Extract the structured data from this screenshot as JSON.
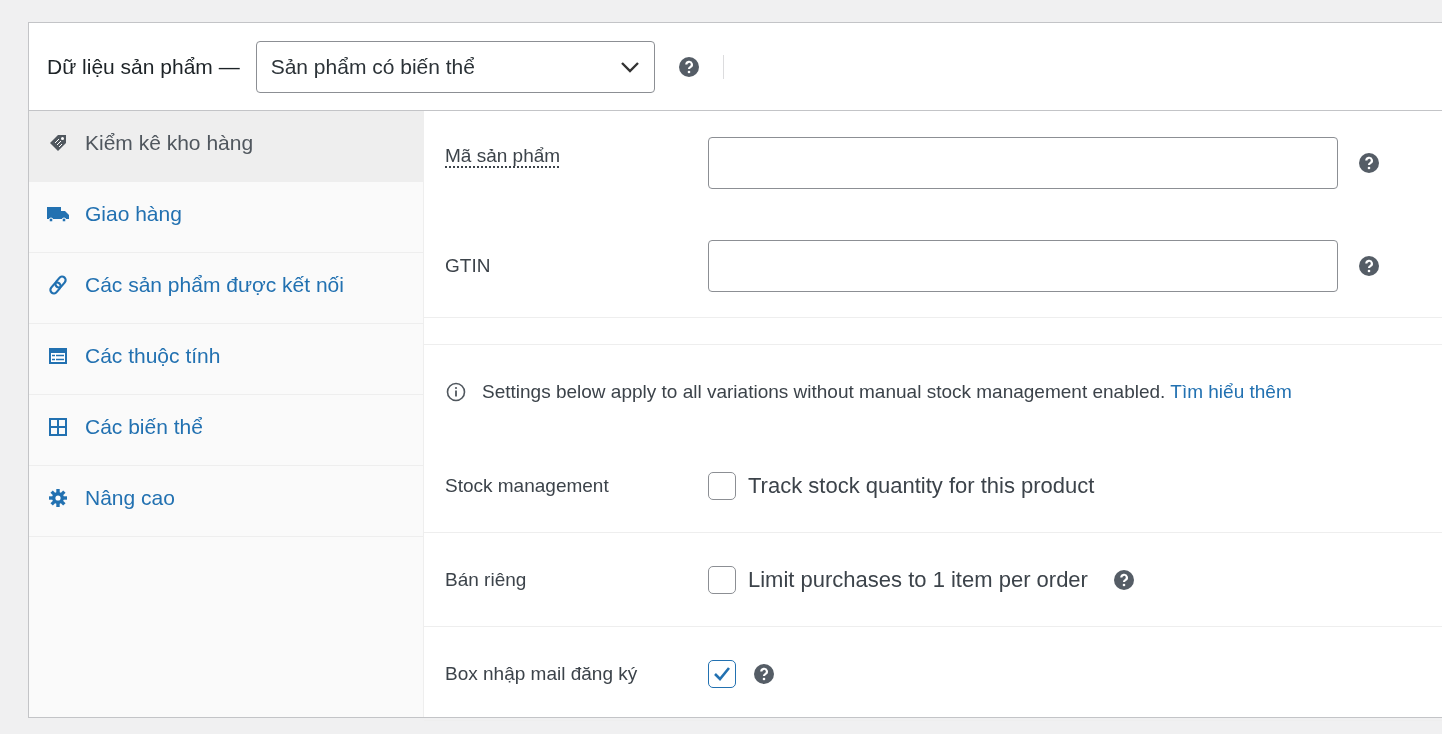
{
  "header": {
    "label": "Dữ liệu sản phẩm —",
    "product_type": "Sản phẩm có biến thể",
    "help": true
  },
  "tabs": [
    {
      "label": "Kiểm kê kho hàng",
      "kind": "tag",
      "selected": true
    },
    {
      "label": "Giao hàng",
      "kind": "truck",
      "selected": false
    },
    {
      "label": "Các sản phẩm được kết nối",
      "kind": "link",
      "selected": false
    },
    {
      "label": "Các thuộc tính",
      "kind": "list",
      "selected": false
    },
    {
      "label": "Các biến thể",
      "kind": "grid",
      "selected": false
    },
    {
      "label": "Nâng cao",
      "kind": "gear",
      "selected": false
    }
  ],
  "fields": [
    {
      "label": "Mã sản phẩm",
      "tooltip": true,
      "help": true
    },
    {
      "label": "GTIN",
      "tooltip": false,
      "help": true
    }
  ],
  "notice": {
    "text": "Settings below apply to all variations without manual stock management enabled.",
    "link": "Tìm hiểu thêm"
  },
  "options": [
    {
      "label": "Stock management",
      "text": "Track stock quantity for this product",
      "checked": false,
      "help": false
    },
    {
      "label": "Bán riêng",
      "text": "Limit purchases to 1 item per order",
      "checked": false,
      "help": true
    },
    {
      "label": "Box nhập mail đăng ký",
      "checked": true,
      "help": true
    }
  ]
}
